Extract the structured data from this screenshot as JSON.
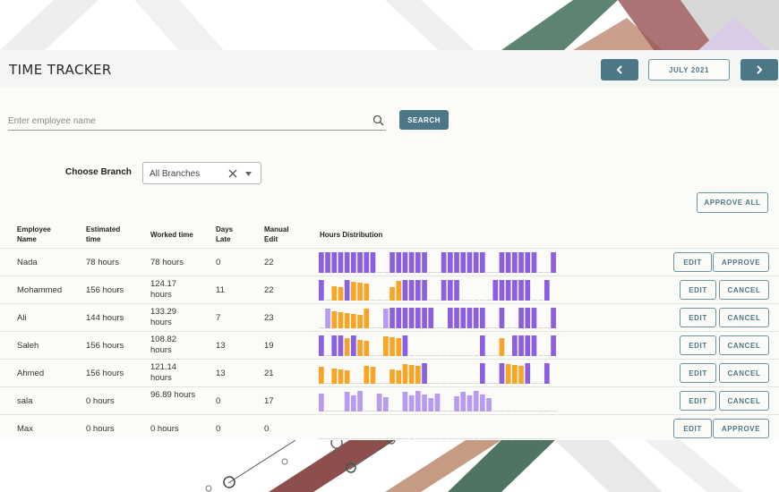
{
  "colors": {
    "accent": "#4b7787",
    "bar_regular": "#8c5fe0",
    "bar_overtime": "#f8a426",
    "bar_light": "#b89af0",
    "bar_empty": "#d9d9d9"
  },
  "header": {
    "title": "TIME TRACKER",
    "month": "JULY 2021",
    "prev_icon": "chevron-left-icon",
    "next_icon": "chevron-right-icon"
  },
  "search": {
    "placeholder": "Enter employee name",
    "value": "",
    "button_label": "SEARCH",
    "icon": "search-icon"
  },
  "branch": {
    "label": "Choose Branch",
    "value": "All Branches"
  },
  "approve_all_label": "APPROVE ALL",
  "table": {
    "headers": {
      "name": [
        "Employee",
        "Name"
      ],
      "estimated": [
        "Estimated",
        "time"
      ],
      "worked": [
        "Worked time"
      ],
      "late": [
        "Days",
        "Late"
      ],
      "manual": [
        "Manual",
        "Edit"
      ],
      "distribution": [
        "Hours Distribution"
      ]
    },
    "rows": [
      {
        "name": "Nada",
        "estimated": "78 hours",
        "worked": "78 hours",
        "late": "0",
        "manual": "22",
        "edit": "EDIT",
        "action": "APPROVE",
        "days": "PPPPPPPPPEEPPPPPPEEPPPPPPPEEPPPPPPEEP"
      },
      {
        "name": "Mohammed",
        "estimated": "156 hours",
        "worked": "124.17 hours",
        "late": "11",
        "manual": "22",
        "edit": "EDIT",
        "action": "CANCEL",
        "days": "PEOOPOOOEEEOOPPPPEEPPPEEEEEPPPPPPEEP"
      },
      {
        "name": "Ali",
        "estimated": "144 hours",
        "worked": "133.29 hours",
        "late": "7",
        "manual": "23",
        "edit": "EDIT",
        "action": "CANCEL",
        "days": "ELOOOOOOEELPPPPPPPEEPPPPPPEEPEEPPPEEP"
      },
      {
        "name": "Saleh",
        "estimated": "156 hours",
        "worked": "108.82 hours",
        "late": "13",
        "manual": "19",
        "edit": "EDIT",
        "action": "CANCEL",
        "days": "PEPPOPOOEEOOOPEEEEEEEEEEEPEEOEPPPPEEP"
      },
      {
        "name": "Ahmed",
        "estimated": "156 hours",
        "worked": "121.14 hours",
        "late": "13",
        "manual": "21",
        "edit": "EDIT",
        "action": "CANCEL",
        "days": "OEOOOEEOOEEOOOOOPEEEEEEEEPEEPOOOPEEP"
      },
      {
        "name": "sala",
        "estimated": "0 hours",
        "worked": "96.89 hours",
        "late": "0",
        "manual": "17",
        "edit": "EDIT",
        "action": "CANCEL",
        "days": "LEEELLLEELLEELLLLLLEELLLLLLEEEEEEEEEE"
      },
      {
        "name": "Max",
        "estimated": "0 hours",
        "worked": "0 hours",
        "late": "0",
        "manual": "0",
        "edit": "EDIT",
        "action": "APPROVE",
        "days": "EEEEEEEEEEEEEEEEEEEEEEEEEEEEEEEEEEEEE"
      }
    ]
  }
}
